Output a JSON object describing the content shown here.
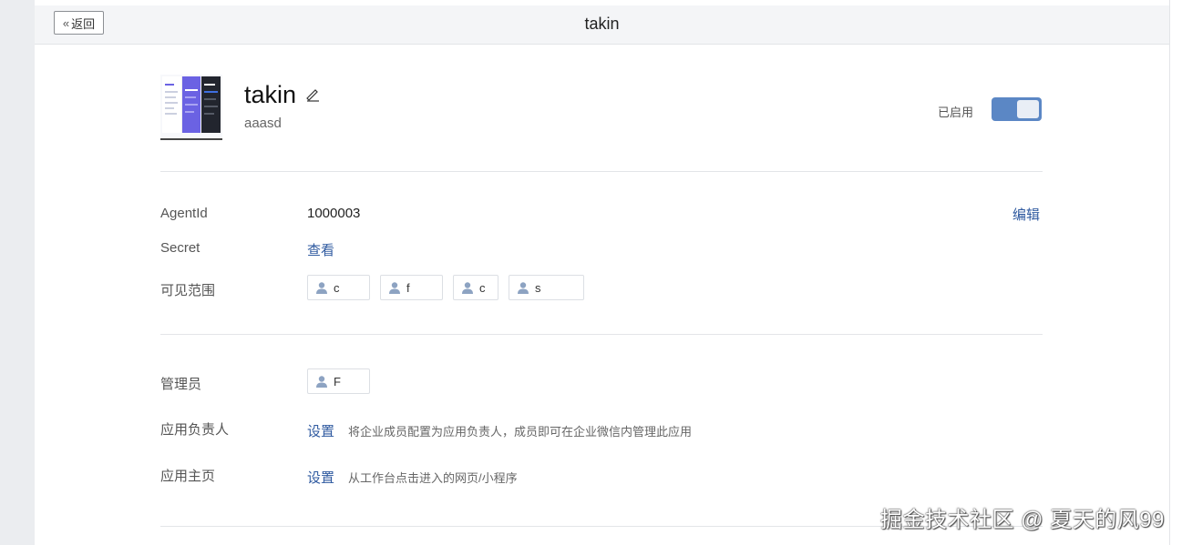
{
  "header": {
    "back_label": "返回",
    "title": "takin"
  },
  "app": {
    "name": "takin",
    "description": "aaasd",
    "status_label": "已启用",
    "enabled": true
  },
  "details": {
    "agentid_label": "AgentId",
    "agentid_value": "1000003",
    "edit_label": "编辑",
    "secret_label": "Secret",
    "secret_action": "查看",
    "visible_label": "可见范围",
    "visible_members": [
      "c",
      "f",
      "c",
      "s"
    ]
  },
  "management": {
    "admin_label": "管理员",
    "admin_member": "F",
    "owner_label": "应用负责人",
    "owner_action": "设置",
    "owner_hint": "将企业成员配置为应用负责人，成员即可在企业微信内管理此应用",
    "homepage_label": "应用主页",
    "homepage_action": "设置",
    "homepage_hint": "从工作台点击进入的网页/小程序"
  },
  "watermark": "掘金技术社区 @ 夏天的风99",
  "colors": {
    "accent": "#2f5aa0",
    "toggle_on": "#5b87c5",
    "divider": "#e3e5e8"
  },
  "icons": [
    "double-chevron-left-icon",
    "edit-pencil-icon",
    "person-icon"
  ]
}
